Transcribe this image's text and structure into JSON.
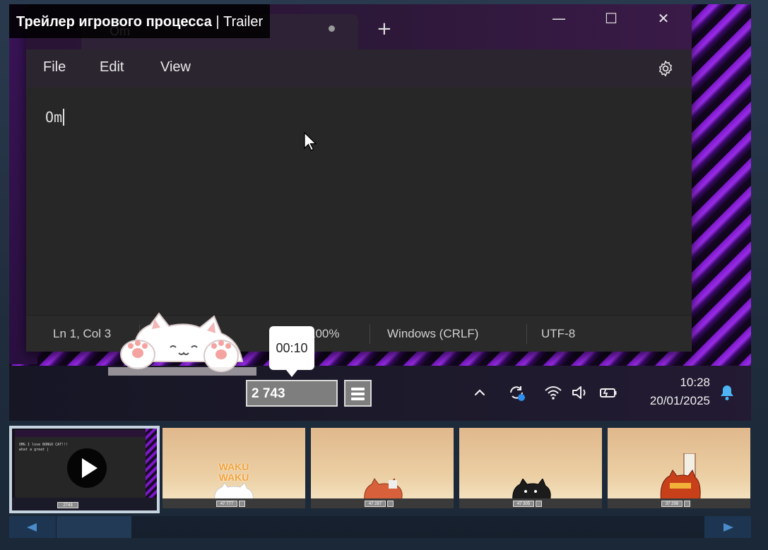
{
  "video": {
    "title_bold": "Трейлер игрового процесса",
    "title_separator": " | ",
    "title_type": "Trailer"
  },
  "notepad": {
    "tab_title": "Om",
    "add_tab": "+",
    "window_controls": {
      "minimize": "—",
      "maximize": "☐",
      "close": "✕"
    },
    "menu": {
      "file": "File",
      "edit": "Edit",
      "view": "View"
    },
    "editor_text": "Om",
    "status": {
      "position": "Ln 1, Col 3",
      "zoom": "100%",
      "line_endings": "Windows (CRLF)",
      "encoding": "UTF-8"
    }
  },
  "taskbar": {
    "counter": "2 743",
    "timestamp_tooltip": "00:10",
    "clock_time": "10:28",
    "clock_date": "20/01/2025",
    "tray_icons": [
      "chevron-up-icon",
      "sync-icon",
      "wifi-icon",
      "volume-icon",
      "battery-icon",
      "bell-icon"
    ]
  },
  "thumbnails": {
    "items": [
      {
        "kind": "video",
        "mini_text_1": "OMG I love BONGO CAT!!!",
        "mini_text_2": "what a great |",
        "mini_counter": "2743"
      },
      {
        "kind": "screenshot",
        "mini_counter": "47 777",
        "art": "WAKU WAKU"
      },
      {
        "kind": "screenshot",
        "mini_counter": "47 287"
      },
      {
        "kind": "screenshot",
        "mini_counter": "47 305"
      },
      {
        "kind": "screenshot",
        "mini_counter": "37 298"
      }
    ]
  },
  "colors": {
    "accent_purple": "#9a2ce8",
    "scroll_arrow": "#4a8bcb",
    "selected_border": "#c6d4df"
  }
}
